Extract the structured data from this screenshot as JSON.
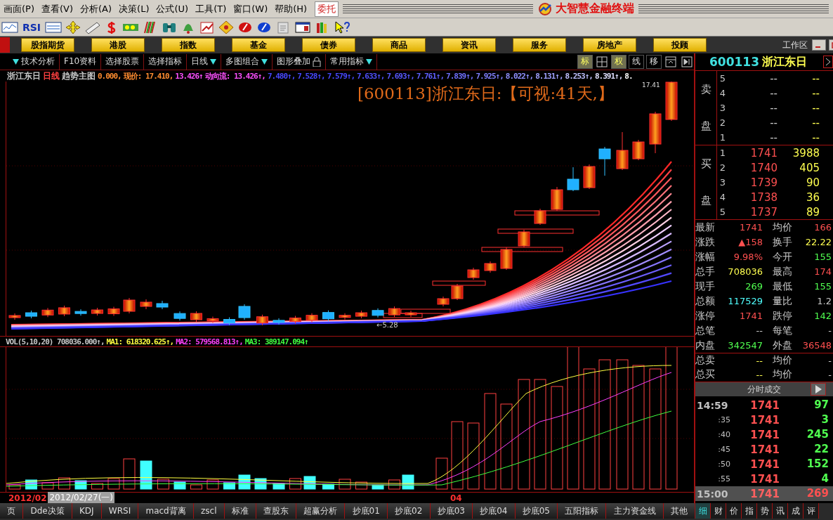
{
  "menu_bar": {
    "menus": [
      "画面(P)",
      "查看(V)",
      "分析(A)",
      "决策(L)",
      "公式(U)",
      "工具(T)",
      "窗口(W)",
      "帮助(H)"
    ],
    "order_button": "委托",
    "app_title": "大智慧金融终端"
  },
  "toolbar": {
    "rsi_label": "RSI"
  },
  "nav_bar": {
    "buttons": [
      "股指期货",
      "港股",
      "指数",
      "基金",
      "债券",
      "商品",
      "资讯",
      "服务",
      "房地产",
      "投顾"
    ],
    "workspace": "工作区"
  },
  "chart_toolbar": {
    "menus": [
      {
        "label": "技术分析",
        "kind": "leading"
      },
      {
        "label": "F10资料",
        "kind": "plain"
      },
      {
        "label": "选择股票",
        "kind": "plain"
      },
      {
        "label": "选择指标",
        "kind": "plain"
      },
      {
        "label": "日线",
        "kind": "dropdown"
      },
      {
        "label": "多图组合",
        "kind": "dropdown"
      },
      {
        "label": "图形叠加",
        "kind": "locked"
      },
      {
        "label": "常用指标",
        "kind": "dropdown"
      }
    ],
    "toggles": [
      {
        "label": "标",
        "selected": true
      },
      {
        "label": "权",
        "selected": true
      },
      {
        "label": "线",
        "selected": false
      },
      {
        "label": "移",
        "selected": false
      }
    ]
  },
  "chart": {
    "legend": [
      {
        "text": "浙江东日",
        "color": "#c8c8c8"
      },
      {
        "text": "日线",
        "color": "#ff4040"
      },
      {
        "text": "趋势主图",
        "color": "#c8c8c8"
      },
      {
        "text": "0.000,",
        "color": "#ff8c30"
      },
      {
        "text": "现价: 17.410,",
        "color": "#ff8c30"
      },
      {
        "text": "13.426↑",
        "color": "#ff50ff"
      },
      {
        "text": "动向流: 13.426↑,",
        "color": "#ff50ff"
      },
      {
        "text": "7.480↑,",
        "color": "#4848ff"
      },
      {
        "text": "7.528↑,",
        "color": "#4848ff"
      },
      {
        "text": "7.579↑,",
        "color": "#4848ff"
      },
      {
        "text": "7.633↑,",
        "color": "#5050ff"
      },
      {
        "text": "7.693↑,",
        "color": "#5858ff"
      },
      {
        "text": "7.761↑,",
        "color": "#6060ff"
      },
      {
        "text": "7.839↑,",
        "color": "#7070ff"
      },
      {
        "text": "7.925↑,",
        "color": "#8080ff"
      },
      {
        "text": "8.022↑,",
        "color": "#9090ff"
      },
      {
        "text": "8.131↑,",
        "color": "#a0a0ff"
      },
      {
        "text": "8.253↑,",
        "color": "#c0c0ff"
      },
      {
        "text": "8.391↑,",
        "color": "#e0e0ff"
      },
      {
        "text": "8.",
        "color": "#ffffff"
      }
    ],
    "overlay_title": "[600113]浙江东日:【可视:41天,】",
    "high_label": "17.41",
    "low_label": "←5.28"
  },
  "volume": {
    "legend": [
      {
        "text": "VOL(5,10,20) 708036.000↑,",
        "color": "#c8c8c8"
      },
      {
        "text": "MA1: 618320.625↑,",
        "color": "#ffff40"
      },
      {
        "text": "MA2: 579568.813↑,",
        "color": "#ff40ff"
      },
      {
        "text": "MA3: 389147.094↑",
        "color": "#40ff40"
      }
    ]
  },
  "date_axis": {
    "labels": [
      {
        "text": "2012/02",
        "selected": false
      },
      {
        "text": "2012/02/27(一)",
        "selected": true
      },
      {
        "text": "04",
        "selected": false
      }
    ]
  },
  "bottom_tabs": [
    "页",
    "Dde决策",
    "KDJ",
    "WRSI",
    "macd背离",
    "zscl",
    "标准",
    "查股东",
    "超赢分析",
    "抄底01",
    "抄底02",
    "抄底03",
    "抄底04",
    "抄底05",
    "五阳指标",
    "主力资金线",
    "其他"
  ],
  "quote_panel": {
    "code": "600113",
    "name": "浙江东日",
    "sell_labels": [
      "卖",
      "盘"
    ],
    "sell": [
      {
        "level": "5",
        "price": "--",
        "volume": "--"
      },
      {
        "level": "4",
        "price": "--",
        "volume": "--"
      },
      {
        "level": "3",
        "price": "--",
        "volume": "--"
      },
      {
        "level": "2",
        "price": "--",
        "volume": "--"
      },
      {
        "level": "1",
        "price": "--",
        "volume": "--"
      }
    ],
    "buy_labels": [
      "买",
      "盘"
    ],
    "buy": [
      {
        "level": "1",
        "price": "1741",
        "volume": "3988"
      },
      {
        "level": "2",
        "price": "1740",
        "volume": "405"
      },
      {
        "level": "3",
        "price": "1739",
        "volume": "90"
      },
      {
        "level": "4",
        "price": "1738",
        "volume": "36"
      },
      {
        "level": "5",
        "price": "1737",
        "volume": "89"
      }
    ],
    "stats": [
      {
        "label": "最新",
        "value": "1741",
        "color": "#ff5050"
      },
      {
        "label": "均价",
        "value": "166",
        "color": "#ff5050"
      },
      {
        "label": "涨跌",
        "value": "▲158",
        "color": "#ff5050"
      },
      {
        "label": "换手",
        "value": "22.22",
        "color": "#ffff50"
      },
      {
        "label": "涨幅",
        "value": "9.98%",
        "color": "#ff5050"
      },
      {
        "label": "今开",
        "value": "155",
        "color": "#50ff50"
      },
      {
        "label": "总手",
        "value": "708036",
        "color": "#ffff50"
      },
      {
        "label": "最高",
        "value": "174",
        "color": "#ff5050"
      },
      {
        "label": "现手",
        "value": "269",
        "color": "#50ff50"
      },
      {
        "label": "最低",
        "value": "155",
        "color": "#50ff50"
      },
      {
        "label": "总额",
        "value": "117529",
        "color": "#50ffff"
      },
      {
        "label": "量比",
        "value": "1.2",
        "color": "#c8c8c8"
      },
      {
        "label": "涨停",
        "value": "1741",
        "color": "#ff5050"
      },
      {
        "label": "跌停",
        "value": "142",
        "color": "#50ff50"
      },
      {
        "label": "总笔",
        "value": "--",
        "color": "#c8c8c8"
      },
      {
        "label": "每笔",
        "value": "-",
        "color": "#c8c8c8"
      },
      {
        "label": "内盘",
        "value": "342547",
        "color": "#50ff50"
      },
      {
        "label": "外盘",
        "value": "36548",
        "color": "#ff5050"
      }
    ],
    "totals": [
      {
        "label": "总卖",
        "value": "--"
      },
      {
        "label": "均价",
        "value": "-"
      },
      {
        "label": "总买",
        "value": "--"
      },
      {
        "label": "均价",
        "value": "-"
      }
    ],
    "ticks_header": "分时成交",
    "ticks": [
      {
        "time": "14:59",
        "price": "1741",
        "volume": "97",
        "color": "#50ff50",
        "selected": false
      },
      {
        "time": ":35",
        "price": "1741",
        "volume": "3",
        "color": "#50ff50",
        "selected": false
      },
      {
        "time": ":40",
        "price": "1741",
        "volume": "245",
        "color": "#50ff50",
        "selected": false
      },
      {
        "time": ":45",
        "price": "1741",
        "volume": "22",
        "color": "#50ff50",
        "selected": false
      },
      {
        "time": ":50",
        "price": "1741",
        "volume": "152",
        "color": "#50ff50",
        "selected": false
      },
      {
        "time": ":55",
        "price": "1741",
        "volume": "4",
        "color": "#50ff50",
        "selected": false
      },
      {
        "time": "15:00",
        "price": "1741",
        "volume": "269",
        "color": "#ff5050",
        "selected": true
      }
    ],
    "side_tabs": [
      {
        "label": "细",
        "selected": true
      },
      {
        "label": "财",
        "selected": false
      },
      {
        "label": "价",
        "selected": false
      },
      {
        "label": "指",
        "selected": false
      },
      {
        "label": "势",
        "selected": false
      },
      {
        "label": "讯",
        "selected": false
      },
      {
        "label": "成",
        "selected": false
      },
      {
        "label": "评",
        "selected": false
      }
    ]
  }
}
